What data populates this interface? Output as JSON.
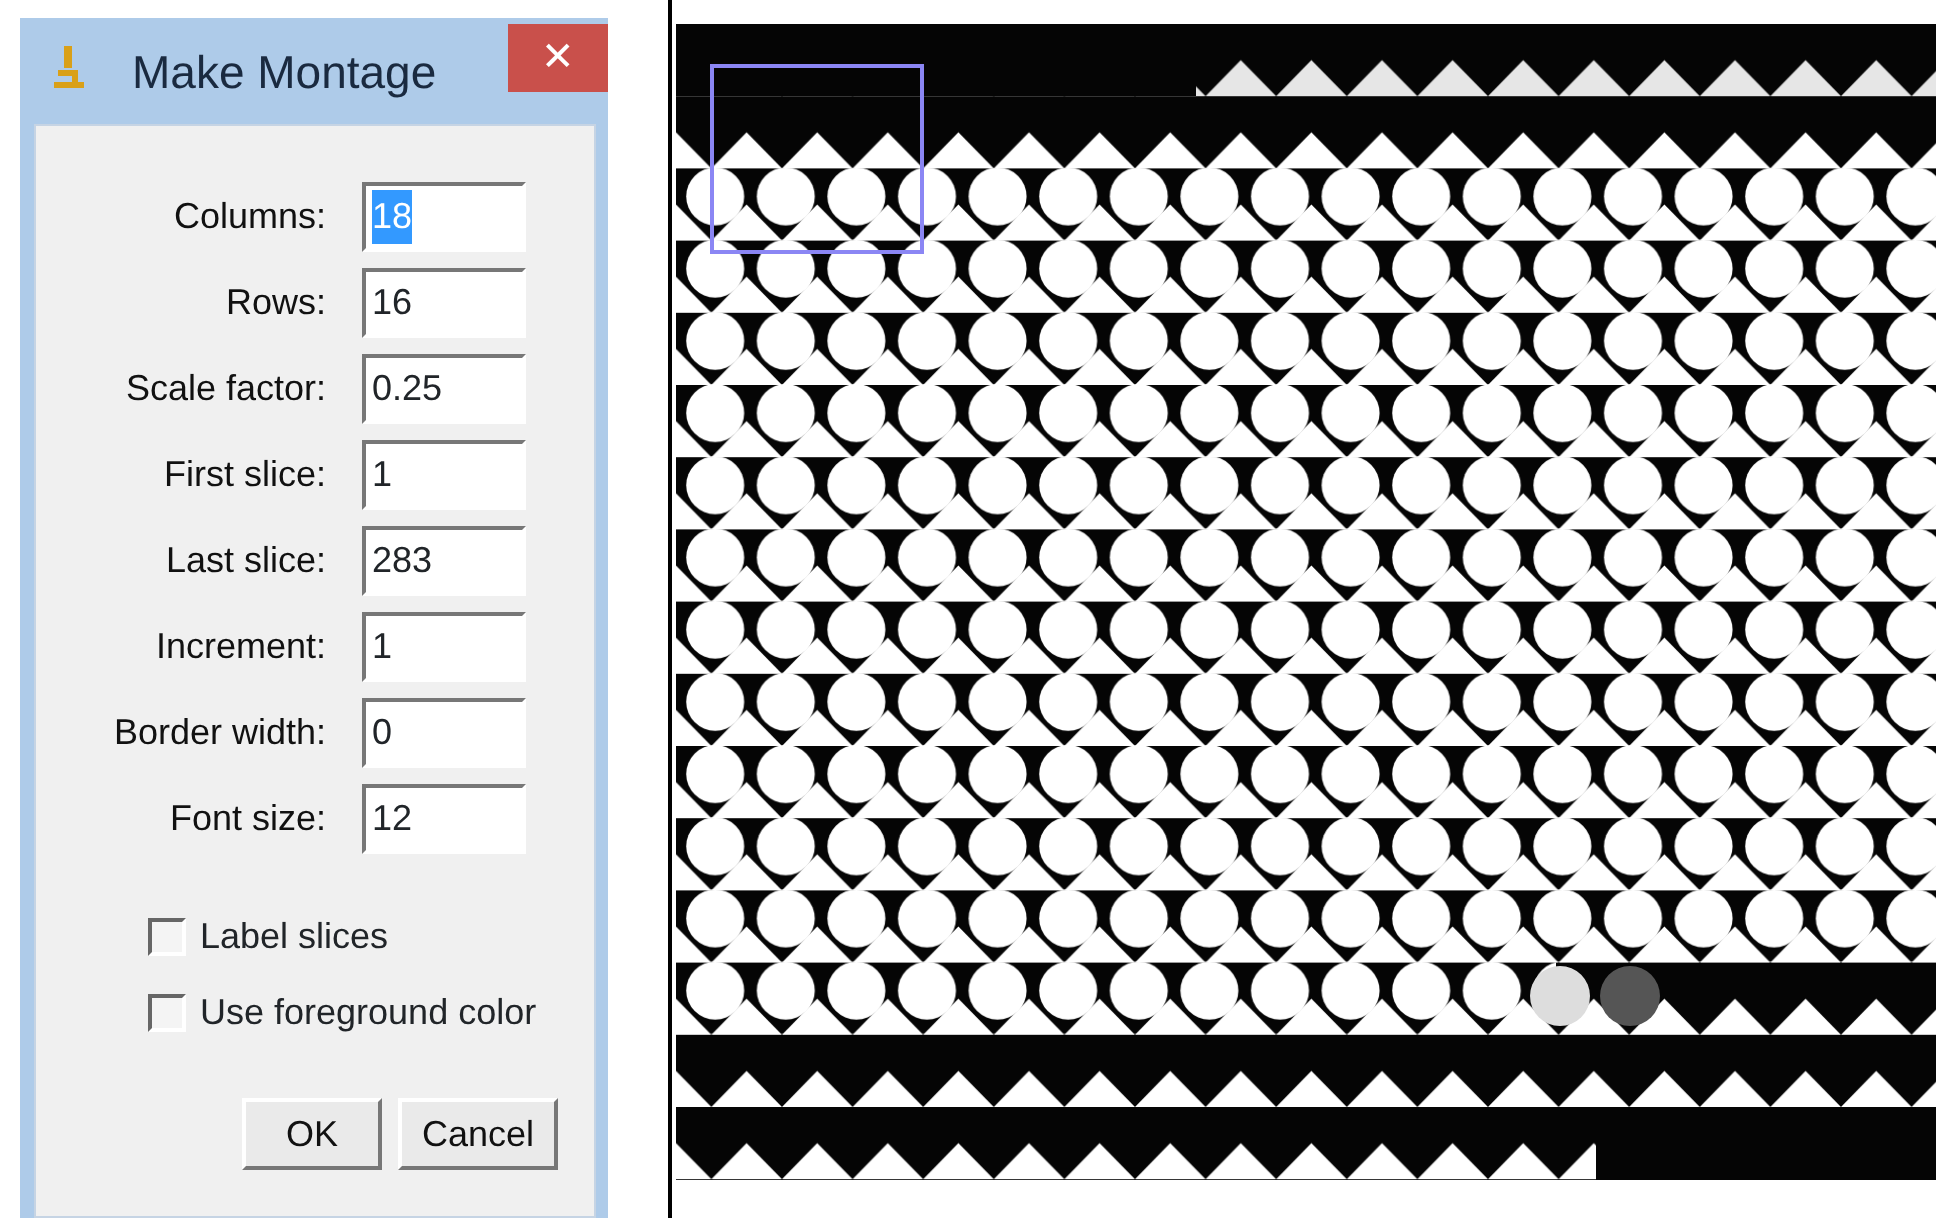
{
  "dialog": {
    "title": "Make Montage",
    "close_glyph": "✕",
    "fields": [
      {
        "label": "Columns:",
        "value": "18",
        "text_selected": true
      },
      {
        "label": "Rows:",
        "value": "16",
        "text_selected": false
      },
      {
        "label": "Scale factor:",
        "value": "0.25",
        "text_selected": false
      },
      {
        "label": "First slice:",
        "value": "1",
        "text_selected": false
      },
      {
        "label": "Last slice:",
        "value": "283",
        "text_selected": false
      },
      {
        "label": "Increment:",
        "value": "1",
        "text_selected": false
      },
      {
        "label": "Border width:",
        "value": "0",
        "text_selected": false
      },
      {
        "label": "Font size:",
        "value": "12",
        "text_selected": false
      }
    ],
    "checkboxes": [
      {
        "label": "Label slices",
        "checked": false
      },
      {
        "label": "Use foreground color",
        "checked": false
      }
    ],
    "buttons": [
      "OK",
      "Cancel"
    ]
  }
}
